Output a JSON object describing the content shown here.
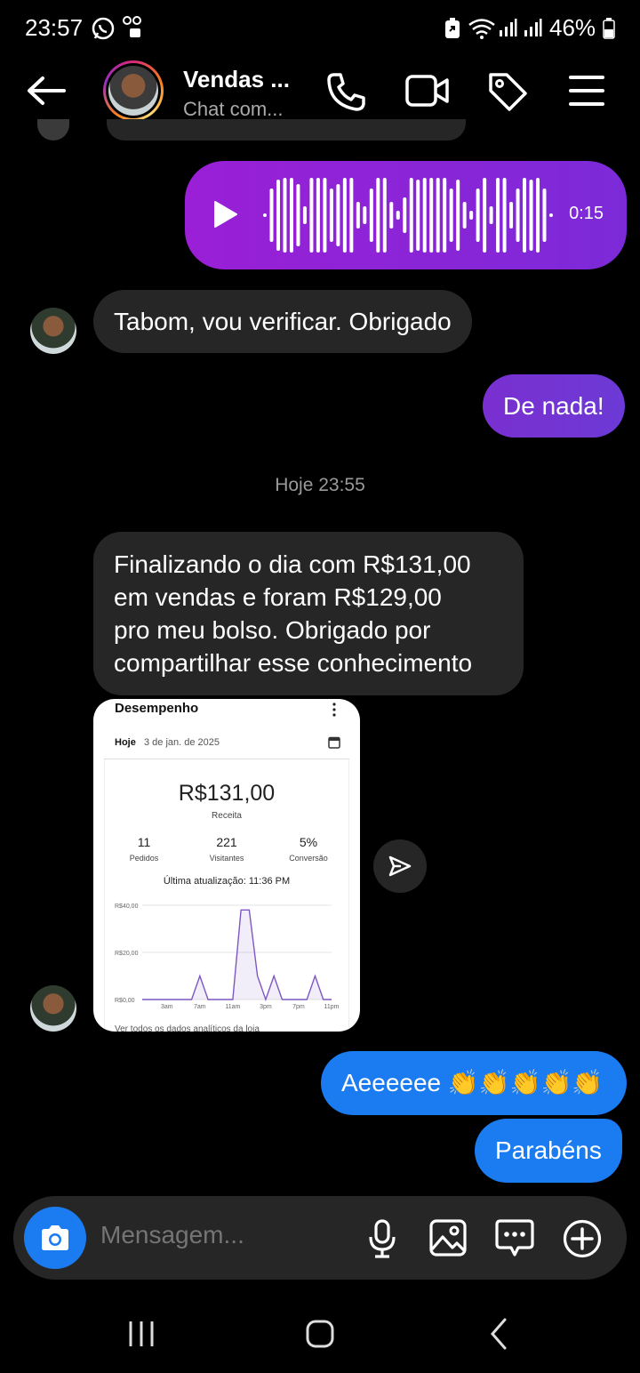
{
  "status_bar": {
    "time": "23:57",
    "battery": "46%"
  },
  "header": {
    "title": "Vendas ...",
    "subtitle": "Chat com..."
  },
  "messages": {
    "audio_duration": "0:15",
    "m1": "Tabom, vou verificar. Obrigado",
    "m2": "De nada!",
    "day_separator": "Hoje 23:55",
    "m3_lines": [
      "Finalizando o dia com R$131,00",
      "em vendas e foram R$129,00",
      "pro meu bolso. Obrigado por",
      "compartilhar esse conhecimento"
    ],
    "m4": "Aeeeeee 👏👏👏👏👏",
    "m5": "Parabéns"
  },
  "shared_card": {
    "title": "Desempenho",
    "period": "Hoje",
    "date": "3 de jan. de 2025",
    "revenue": "R$131,00",
    "revenue_label": "Receita",
    "stats": [
      {
        "value": "11",
        "label": "Pedidos"
      },
      {
        "value": "221",
        "label": "Visitantes"
      },
      {
        "value": "5%",
        "label": "Conversão"
      }
    ],
    "updated": "Última atualização: 11:36 PM",
    "footer": "Ver todos os dados analíticos da loja"
  },
  "chart_data": {
    "type": "area",
    "x": [
      "12am",
      "1am",
      "2am",
      "3am",
      "4am",
      "5am",
      "6am",
      "7am",
      "8am",
      "9am",
      "10am",
      "11am",
      "12pm",
      "1pm",
      "2pm",
      "3pm",
      "4pm",
      "5pm",
      "6pm",
      "7pm",
      "8pm",
      "9pm",
      "10pm",
      "11pm"
    ],
    "x_tick_labels": [
      "3am",
      "7am",
      "11am",
      "3pm",
      "7pm",
      "11pm"
    ],
    "y_tick_labels": [
      "R$40,00",
      "R$20,00",
      "R$0,00"
    ],
    "values": [
      0,
      0,
      0,
      0,
      0,
      0,
      0,
      10,
      0,
      0,
      0,
      0,
      38,
      38,
      10,
      0,
      10,
      0,
      0,
      0,
      0,
      10,
      0,
      0
    ],
    "ylim": [
      0,
      40
    ],
    "color": "#7e57c2"
  },
  "composer": {
    "placeholder": "Mensagem..."
  },
  "colors": {
    "sent_purple": "#7a2fd0",
    "sent_blue": "#1a7cf0",
    "received_gray": "#262626"
  }
}
